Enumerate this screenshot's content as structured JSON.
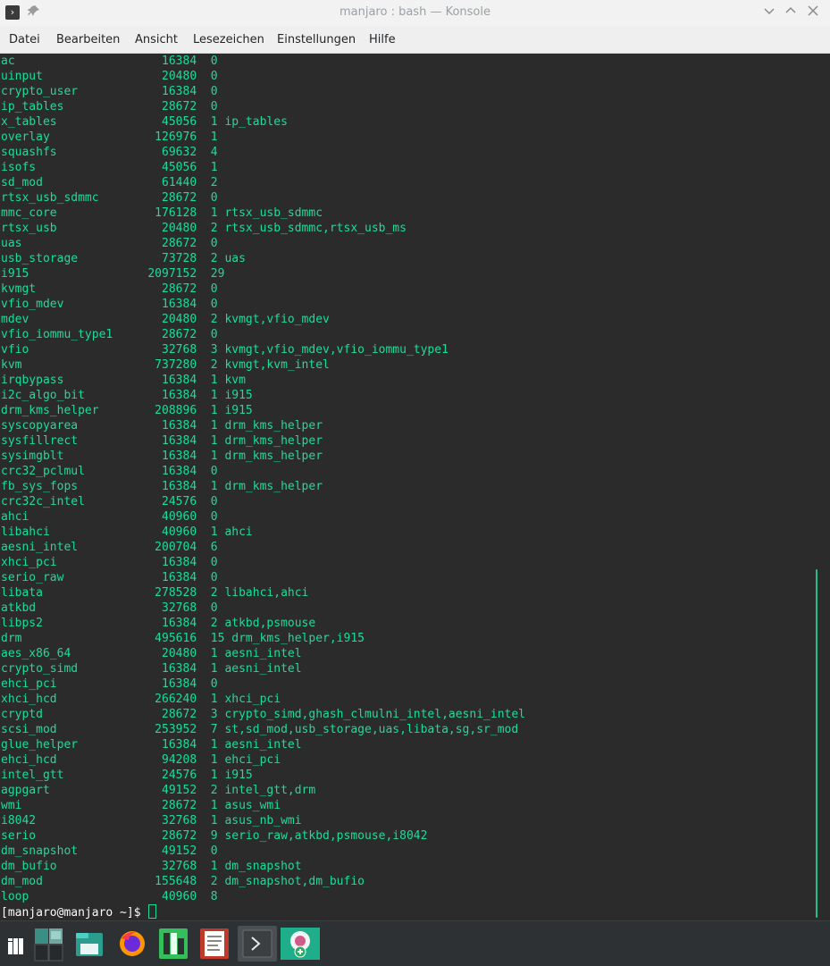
{
  "window": {
    "title": "manjaro : bash — Konsole"
  },
  "menu": [
    "Datei",
    "Bearbeiten",
    "Ansicht",
    "Lesezeichen",
    "Einstellungen",
    "Hilfe"
  ],
  "terminal": {
    "lines": [
      "ac                     16384  0",
      "uinput                 20480  0",
      "crypto_user            16384  0",
      "ip_tables              28672  0",
      "x_tables               45056  1 ip_tables",
      "overlay               126976  1",
      "squashfs               69632  4",
      "isofs                  45056  1",
      "sd_mod                 61440  2",
      "rtsx_usb_sdmmc         28672  0",
      "mmc_core              176128  1 rtsx_usb_sdmmc",
      "rtsx_usb               20480  2 rtsx_usb_sdmmc,rtsx_usb_ms",
      "uas                    28672  0",
      "usb_storage            73728  2 uas",
      "i915                 2097152  29",
      "kvmgt                  28672  0",
      "vfio_mdev              16384  0",
      "mdev                   20480  2 kvmgt,vfio_mdev",
      "vfio_iommu_type1       28672  0",
      "vfio                   32768  3 kvmgt,vfio_mdev,vfio_iommu_type1",
      "kvm                   737280  2 kvmgt,kvm_intel",
      "irqbypass              16384  1 kvm",
      "i2c_algo_bit           16384  1 i915",
      "drm_kms_helper        208896  1 i915",
      "syscopyarea            16384  1 drm_kms_helper",
      "sysfillrect            16384  1 drm_kms_helper",
      "sysimgblt              16384  1 drm_kms_helper",
      "crc32_pclmul           16384  0",
      "fb_sys_fops            16384  1 drm_kms_helper",
      "crc32c_intel           24576  0",
      "ahci                   40960  0",
      "libahci                40960  1 ahci",
      "aesni_intel           200704  6",
      "xhci_pci               16384  0",
      "serio_raw              16384  0",
      "libata                278528  2 libahci,ahci",
      "atkbd                  32768  0",
      "libps2                 16384  2 atkbd,psmouse",
      "drm                   495616  15 drm_kms_helper,i915",
      "aes_x86_64             20480  1 aesni_intel",
      "crypto_simd            16384  1 aesni_intel",
      "ehci_pci               16384  0",
      "xhci_hcd              266240  1 xhci_pci",
      "cryptd                 28672  3 crypto_simd,ghash_clmulni_intel,aesni_intel",
      "scsi_mod              253952  7 st,sd_mod,usb_storage,uas,libata,sg,sr_mod",
      "glue_helper            16384  1 aesni_intel",
      "ehci_hcd               94208  1 ehci_pci",
      "intel_gtt              24576  1 i915",
      "agpgart                49152  2 intel_gtt,drm",
      "wmi                    28672  1 asus_wmi",
      "i8042                  32768  1 asus_nb_wmi",
      "serio                  28672  9 serio_raw,atkbd,psmouse,i8042",
      "dm_snapshot            49152  0",
      "dm_bufio               32768  1 dm_snapshot",
      "dm_mod                155648  2 dm_snapshot,dm_bufio",
      "loop                   40960  8"
    ],
    "prompt": "[manjaro@manjaro ~]$ "
  },
  "taskbar": {
    "items": [
      {
        "name": "application-launcher-icon"
      },
      {
        "name": "pager-icon"
      },
      {
        "name": "file-manager-icon"
      },
      {
        "name": "firefox-icon"
      },
      {
        "name": "manjaro-settings-icon"
      },
      {
        "name": "text-editor-icon"
      },
      {
        "name": "konsole-icon",
        "active": true
      },
      {
        "name": "software-installer-icon"
      }
    ]
  },
  "colors": {
    "terminal_bg": "#2b2b2b",
    "terminal_fg": "#1cdc9a",
    "prompt_fg": "#fcfcfc",
    "titlebar_bg": "#f2f2f2",
    "taskbar_bg": "#2e3133"
  }
}
